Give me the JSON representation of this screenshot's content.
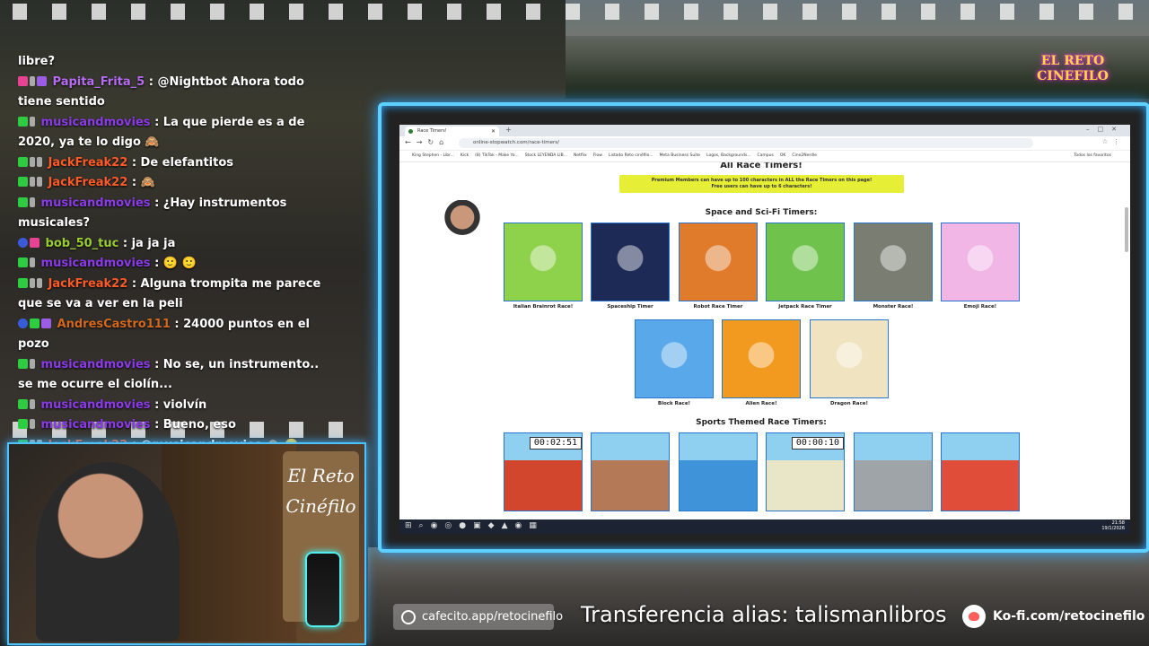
{
  "chat": [
    {
      "badges": [],
      "user": "",
      "user_color": "#ffffff",
      "text": "libre?"
    },
    {
      "badges": [
        "pink",
        "gray",
        "purple"
      ],
      "user": "Papita_Frita_5",
      "user_color": "#b66cf2",
      "text": ": @Nightbot Ahora todo tiene sentido"
    },
    {
      "badges": [
        "green",
        "gray"
      ],
      "user": "musicandmovies",
      "user_color": "#8a3be8",
      "text": ": La que pierde es a de 2020, ya te lo digo 🙈"
    },
    {
      "badges": [
        "green",
        "gray",
        "gray"
      ],
      "user": "JackFreak22",
      "user_color": "#ff5a2a",
      "text": ": De elefantitos"
    },
    {
      "badges": [
        "green",
        "gray",
        "gray"
      ],
      "user": "JackFreak22",
      "user_color": "#ff5a2a",
      "text": ": 🙈"
    },
    {
      "badges": [
        "green",
        "gray"
      ],
      "user": "musicandmovies",
      "user_color": "#8a3be8",
      "text": ": ¿Hay instrumentos musicales?"
    },
    {
      "badges": [
        "blue",
        "pink"
      ],
      "user": "bob_50_tuc",
      "user_color": "#9acd32",
      "text": ": ja ja ja"
    },
    {
      "badges": [
        "green",
        "gray"
      ],
      "user": "musicandmovies",
      "user_color": "#8a3be8",
      "text": ": 🙂 🙂"
    },
    {
      "badges": [
        "green",
        "gray",
        "gray"
      ],
      "user": "JackFreak22",
      "user_color": "#ff5a2a",
      "text": ": Alguna trompita me parece que se va a ver en la peli"
    },
    {
      "badges": [
        "blue",
        "green",
        "purple"
      ],
      "user": "AndresCastro111",
      "user_color": "#d2691e",
      "text": ": 24000 puntos en el pozo"
    },
    {
      "badges": [
        "green",
        "gray"
      ],
      "user": "musicandmovies",
      "user_color": "#8a3be8",
      "text": ": No se, un instrumento.. se me ocurre el ciolín..."
    },
    {
      "badges": [
        "green",
        "gray"
      ],
      "user": "musicandmovies",
      "user_color": "#8a3be8",
      "text": ": violvín"
    },
    {
      "badges": [
        "green",
        "gray"
      ],
      "user": "musicandmovies",
      "user_color": "#8a3be8",
      "text": ": Bueno, eso"
    },
    {
      "badges": [
        "green",
        "gray",
        "gray"
      ],
      "user": "JackFreak22",
      "user_color": "#ff5a2a",
      "text": ": @musicandmovies 🙈 🙂"
    }
  ],
  "logo": {
    "line1": "EL RETO",
    "line2": "CINEFILO"
  },
  "webcam": {
    "sign_line1": "El Reto",
    "sign_line2": "Cinéfilo"
  },
  "browser": {
    "tab_title": "Race Timers!",
    "url": "online-stopwatch.com/race-timers/",
    "bookmarks": [
      "King Stephen - Libr...",
      "Kick",
      "(8) TikTok - Make Yo...",
      "Stock LEYENDA LIB...",
      "Netflix",
      "Flow",
      "Listado Reto cinéfilo...",
      "Meta Business Suite",
      "Logos, Backgrounds...",
      "Campus",
      "OK",
      "Cine2Nerdle"
    ],
    "bookmarks_right": "Todos los favoritos",
    "status_url": "https://www.online-stopwatch.com/block-race/"
  },
  "page": {
    "title": "All Race Timers!",
    "premium_line1": "Premium Members can have up to 100 characters in ALL the Race Timers on this page!",
    "premium_line2": "Free users can have up to 6 characters!",
    "section1": "Space and Sci-Fi Timers:",
    "section2": "Sports Themed Race Timers:",
    "space_tiles": [
      {
        "label": "Italian Brainrot Race!",
        "bg": "#8ed14a"
      },
      {
        "label": "Spaceship Timer",
        "bg": "#1d2a55"
      },
      {
        "label": "Robot Race Timer",
        "bg": "#e07b2c"
      },
      {
        "label": "Jetpack Race Timer",
        "bg": "#6fc24b"
      },
      {
        "label": "Monster Race!",
        "bg": "#7a7d72"
      },
      {
        "label": "Emoji Race!",
        "bg": "#f1b6e6"
      },
      {
        "label": "Block Race!",
        "bg": "#58a8ea"
      },
      {
        "label": "Alien Race!",
        "bg": "#f29a1f"
      },
      {
        "label": "Dragon Race!",
        "bg": "#efe3c0"
      }
    ],
    "sports_tiles": [
      {
        "timer": "00:02:51",
        "bg": "#d2462d"
      },
      {
        "timer": "",
        "bg": "#b47a58"
      },
      {
        "timer": "",
        "bg": "#3f93d9"
      },
      {
        "timer": "00:00:10",
        "bg": "#e9e5c7"
      },
      {
        "timer": "",
        "bg": "#9fa4a9"
      },
      {
        "timer": "",
        "bg": "#e04e3a"
      }
    ]
  },
  "taskbar": {
    "time": "21:58",
    "date": "19/1/2026"
  },
  "banner": {
    "cafecito": "cafecito.app/retocinefilo",
    "alias": "Transferencia alias: talismanlibros",
    "kofi": "Ko-fi.com/retocinefilo"
  }
}
